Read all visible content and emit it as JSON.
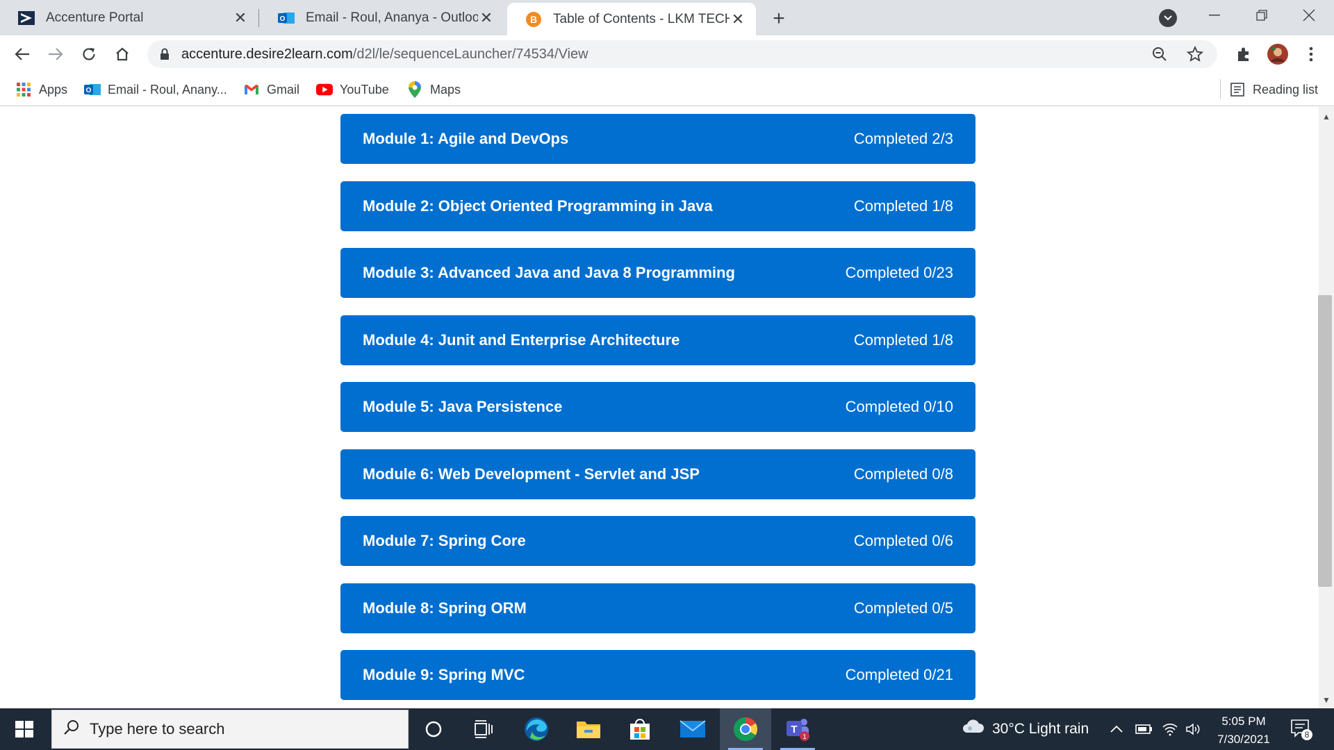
{
  "browser": {
    "tabs": [
      {
        "title": "Accenture Portal",
        "icon": "accenture-icon",
        "active": false
      },
      {
        "title": "Email - Roul, Ananya - Outlook",
        "icon": "outlook-icon",
        "active": false
      },
      {
        "title": "Table of Contents - LKM TECHGE",
        "icon": "brightspace-icon",
        "active": true
      }
    ],
    "new_tab": "+",
    "url_host": "accenture.desire2learn.com",
    "url_path": "/d2l/le/sequenceLauncher/74534/View"
  },
  "bookmarks": {
    "items": [
      {
        "label": "Apps",
        "icon": "apps-grid-icon"
      },
      {
        "label": "Email - Roul, Anany...",
        "icon": "outlook-icon"
      },
      {
        "label": "Gmail",
        "icon": "gmail-icon"
      },
      {
        "label": "YouTube",
        "icon": "youtube-icon"
      },
      {
        "label": "Maps",
        "icon": "maps-icon"
      }
    ],
    "reading_list": "Reading list"
  },
  "modules": [
    {
      "title": "Module 1: Agile and DevOps",
      "status": "Completed 2/3"
    },
    {
      "title": "Module 2: Object Oriented Programming in Java",
      "status": "Completed 1/8"
    },
    {
      "title": "Module 3: Advanced Java and Java 8 Programming",
      "status": "Completed 0/23"
    },
    {
      "title": "Module 4: Junit and Enterprise Architecture",
      "status": "Completed 1/8"
    },
    {
      "title": "Module 5: Java Persistence",
      "status": "Completed 0/10"
    },
    {
      "title": "Module 6: Web Development - Servlet and JSP",
      "status": "Completed 0/8"
    },
    {
      "title": "Module 7: Spring Core",
      "status": "Completed 0/6"
    },
    {
      "title": "Module 8: Spring ORM",
      "status": "Completed 0/5"
    },
    {
      "title": "Module 9: Spring MVC",
      "status": "Completed 0/21"
    }
  ],
  "taskbar": {
    "search_placeholder": "Type here to search",
    "weather": "30°C  Light rain",
    "time": "5:05 PM",
    "date": "7/30/2021",
    "notifications": "8",
    "teams_badge": "1"
  },
  "colors": {
    "module_bg": "#006fcf",
    "tabstrip_bg": "#dee1e6",
    "taskbar_bg": "#1f2a38"
  }
}
